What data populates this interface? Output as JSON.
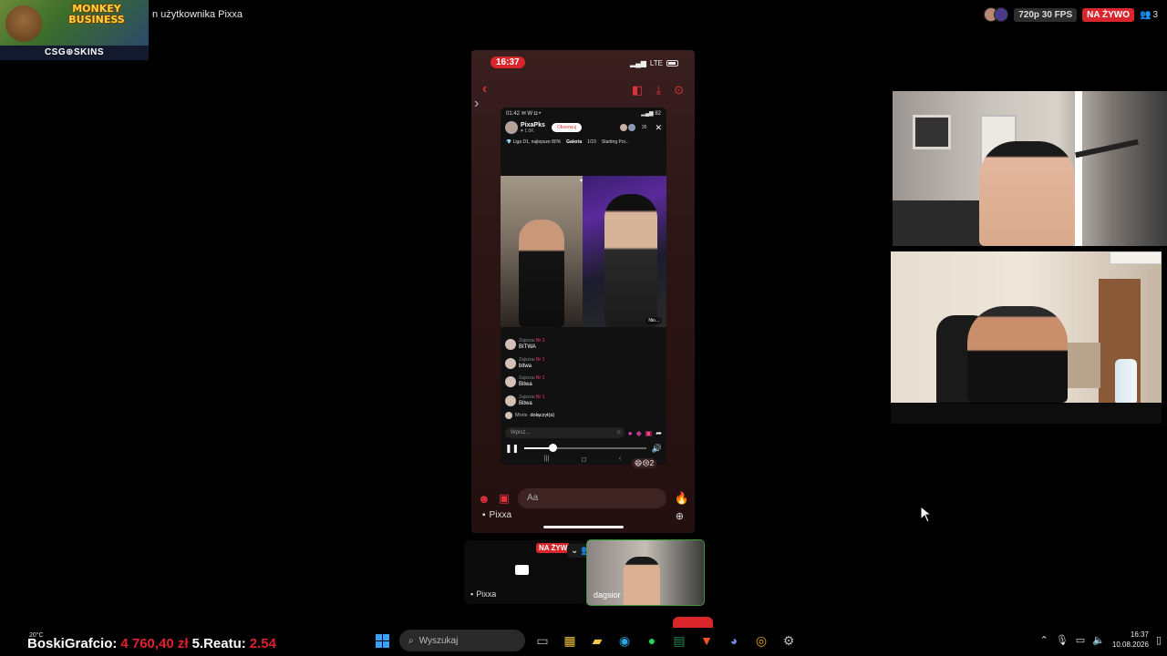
{
  "sponsor": {
    "game_title": "MONKEY BUSINESS",
    "brand": "CSG⊕SKINS"
  },
  "window_title": "n użytkownika Pixxa",
  "stream": {
    "quality": "720p 30 FPS",
    "live_label": "NA ŻYWO",
    "viewers": "3"
  },
  "phone": {
    "time": "16:37",
    "network": "LTE",
    "inner": {
      "time": "01:42",
      "status_letters": "✉ W ◘ •",
      "battery": "82",
      "host_name": "PixaPks",
      "host_likes": "♥ 1.0K",
      "follow_label": "Obserwuj",
      "viewer_count": "35",
      "info_left": "Liga D1, najlepsze 80%",
      "info_gallery": "Galeria",
      "info_page": "1/10",
      "info_right": "Starting Poi...",
      "battle_tag": "Nio...",
      "comments": [
        {
          "user": "Zajszou",
          "rank": "Nr 1",
          "text": "BITWA"
        },
        {
          "user": "Zajszou",
          "rank": "Nr 1",
          "text": "bitwa"
        },
        {
          "user": "Zajszou",
          "rank": "Nr 1",
          "text": "Bitwa"
        },
        {
          "user": "Zajszou",
          "rank": "Nr 1",
          "text": "Bitwa"
        }
      ],
      "joined_name": "Moris",
      "joined_text": "dołączył(a)",
      "input_placeholder": "Wpisz...",
      "reactions": "😄😢2"
    },
    "compose_placeholder": "Aa",
    "sharer": "Pixxa"
  },
  "tiles": {
    "screen_label": "Pixxa",
    "live_label": "NA ŻYW",
    "cam_label": "dagsior"
  },
  "ticker": {
    "weather": "20°C",
    "name": "BoskiGrafcio:",
    "amount": "4 760,40 zł",
    "label2": "5.Reatu:",
    "amount2": "2.54"
  },
  "taskbar": {
    "search_placeholder": "Wyszukaj",
    "time": "16:37",
    "date": "10.08.2026"
  },
  "colors": {
    "accent_red": "#d9252c",
    "taskbar_blue": "#3aa0ff",
    "tile_border": "#3a9a3a"
  }
}
